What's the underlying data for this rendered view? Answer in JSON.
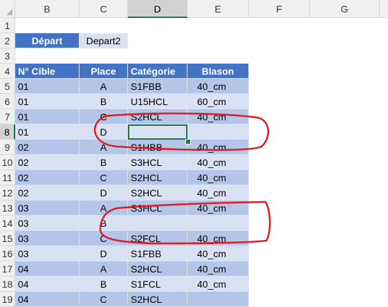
{
  "columns": [
    "B",
    "C",
    "D",
    "E",
    "F",
    "G"
  ],
  "rows": [
    "1",
    "2",
    "3",
    "4",
    "5",
    "6",
    "7",
    "8",
    "9",
    "10",
    "11",
    "12",
    "13",
    "14",
    "15",
    "16",
    "17",
    "18",
    "19"
  ],
  "active_column": "D",
  "active_row": "8",
  "depart": {
    "label": "Départ",
    "value": "Depart2"
  },
  "table": {
    "headers": [
      "N° Cible",
      "Place",
      "Catégorie",
      "Blason"
    ],
    "rows": [
      [
        "01",
        "A",
        "S1FBB",
        "40_cm"
      ],
      [
        "01",
        "B",
        "U15HCL",
        "60_cm"
      ],
      [
        "01",
        "C",
        "S2HCL",
        "40_cm"
      ],
      [
        "01",
        "D",
        "",
        ""
      ],
      [
        "02",
        "A",
        "S1HBB",
        "40_cm"
      ],
      [
        "02",
        "B",
        "S3HCL",
        "40_cm"
      ],
      [
        "02",
        "C",
        "S2HCL",
        "40_cm"
      ],
      [
        "02",
        "D",
        "S2HCL",
        "40_cm"
      ],
      [
        "03",
        "A",
        "S3HCL",
        "40_cm"
      ],
      [
        "03",
        "B",
        "",
        ""
      ],
      [
        "03",
        "C",
        "S2FCL",
        "40_cm"
      ],
      [
        "03",
        "D",
        "S1FBB",
        "40_cm"
      ],
      [
        "04",
        "A",
        "S2HCL",
        "40_cm"
      ],
      [
        "04",
        "B",
        "S1FCL",
        "40_cm"
      ],
      [
        "04",
        "C",
        "S2HCL",
        ""
      ]
    ]
  },
  "colors": {
    "header_blue": "#4472c4",
    "band_dark": "#b4c6e7",
    "band_light": "#d9e1f2",
    "selection_green": "#217346",
    "annotation_red": "#e01b1b"
  }
}
